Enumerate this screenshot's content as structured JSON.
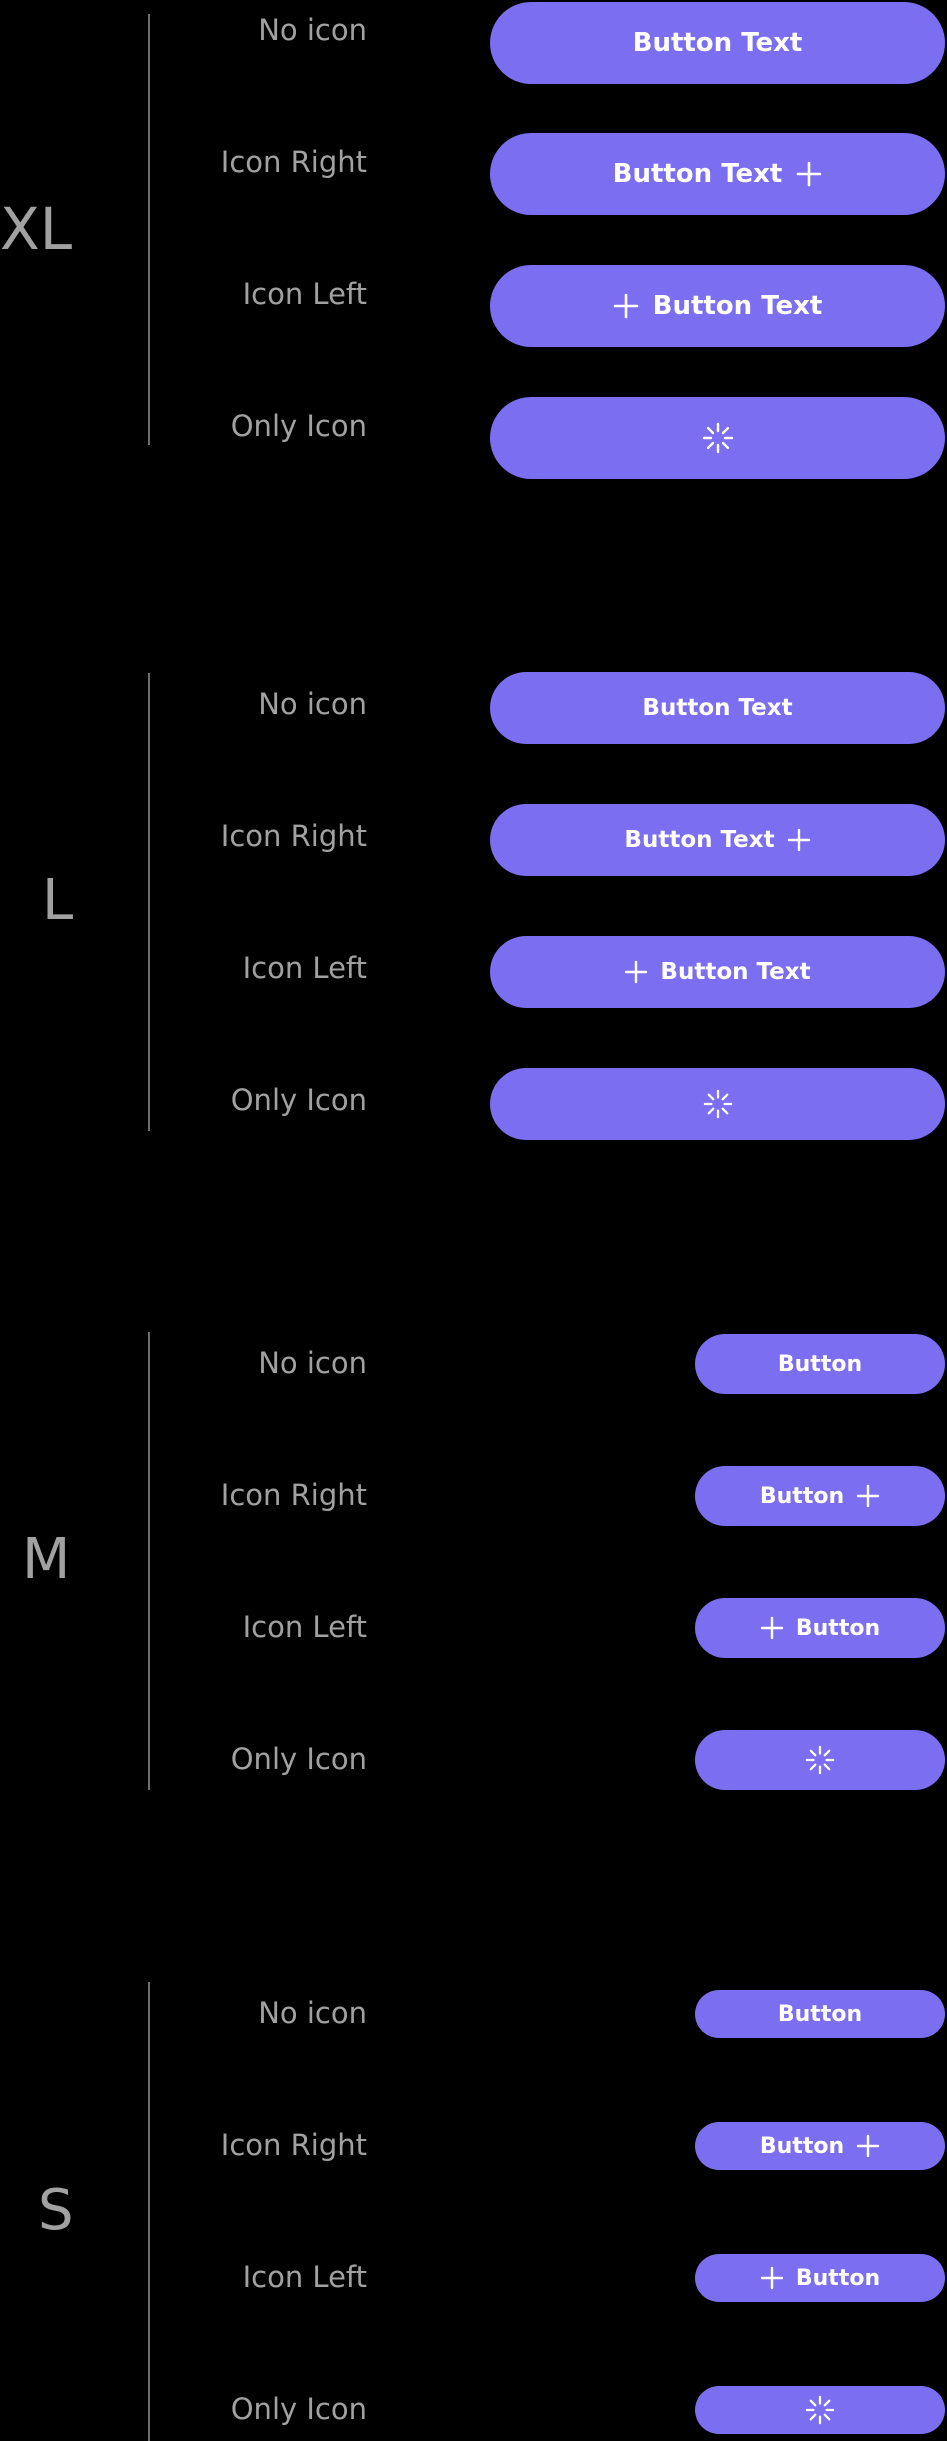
{
  "accent_color": "#7c6ef0",
  "label_color": "#a1a1a1",
  "sections": {
    "xl": {
      "size_label": "XL",
      "rows": {
        "no_icon": {
          "label": "No icon",
          "button": "Button Text"
        },
        "icon_right": {
          "label": "Icon Right",
          "button": "Button Text",
          "icon": "plus-icon"
        },
        "icon_left": {
          "label": "Icon Left",
          "button": "Button Text",
          "icon": "plus-icon"
        },
        "only_icon": {
          "label": "Only Icon",
          "icon": "spinner-icon"
        }
      }
    },
    "l": {
      "size_label": "L",
      "rows": {
        "no_icon": {
          "label": "No icon",
          "button": "Button Text"
        },
        "icon_right": {
          "label": "Icon Right",
          "button": "Button Text",
          "icon": "plus-icon"
        },
        "icon_left": {
          "label": "Icon Left",
          "button": "Button Text",
          "icon": "plus-icon"
        },
        "only_icon": {
          "label": "Only Icon",
          "icon": "spinner-icon"
        }
      }
    },
    "m": {
      "size_label": "M",
      "rows": {
        "no_icon": {
          "label": "No icon",
          "button": "Button"
        },
        "icon_right": {
          "label": "Icon Right",
          "button": "Button",
          "icon": "plus-icon"
        },
        "icon_left": {
          "label": "Icon Left",
          "button": "Button",
          "icon": "plus-icon"
        },
        "only_icon": {
          "label": "Only Icon",
          "icon": "spinner-icon"
        }
      }
    },
    "s": {
      "size_label": "S",
      "rows": {
        "no_icon": {
          "label": "No icon",
          "button": "Button"
        },
        "icon_right": {
          "label": "Icon Right",
          "button": "Button",
          "icon": "plus-icon"
        },
        "icon_left": {
          "label": "Icon Left",
          "button": "Button",
          "icon": "plus-icon"
        },
        "only_icon": {
          "label": "Only Icon",
          "icon": "spinner-icon"
        }
      }
    }
  }
}
